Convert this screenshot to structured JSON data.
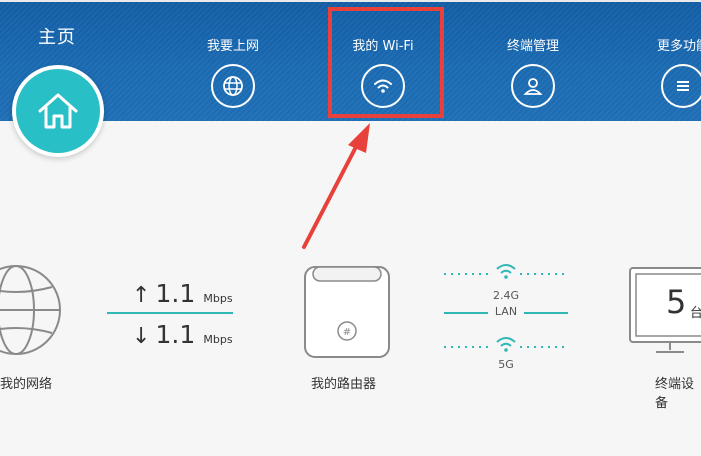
{
  "header": {
    "title": "主页",
    "nav": [
      {
        "label": "我要上网",
        "icon": "globe-icon"
      },
      {
        "label": "我的 Wi-Fi",
        "icon": "wifi-icon"
      },
      {
        "label": "终端管理",
        "icon": "user-icon"
      },
      {
        "label": "更多功能",
        "icon": "menu-icon"
      }
    ]
  },
  "network": {
    "label": "我的网络",
    "upload_value": "1.1",
    "upload_unit": "Mbps",
    "download_value": "1.1",
    "download_unit": "Mbps"
  },
  "router": {
    "label": "我的路由器",
    "logo_text": "#"
  },
  "links": {
    "band_24": "2.4G",
    "lan": "LAN",
    "band_5": "5G"
  },
  "devices": {
    "count": "5",
    "unit": "台",
    "label": "终端设备"
  },
  "colors": {
    "header": "#1b6bb4",
    "accent": "#29bfc6",
    "highlight": "#e8403b"
  }
}
